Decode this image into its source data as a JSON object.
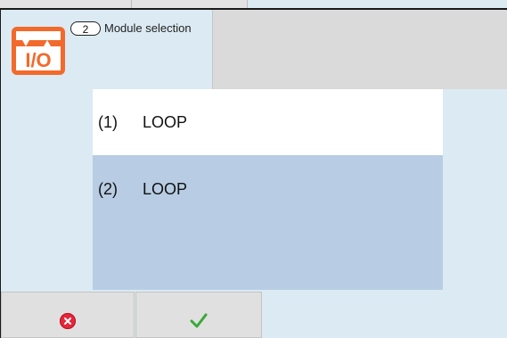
{
  "header": {
    "step_number": "2",
    "title": "Module selection",
    "icon_text": "I/O"
  },
  "modules": [
    {
      "number": "(1)",
      "name": "LOOP",
      "selected": false
    },
    {
      "number": "(2)",
      "name": "LOOP",
      "selected": true
    }
  ],
  "footer": {
    "cancel_icon": "cancel-icon",
    "confirm_icon": "checkmark-icon"
  },
  "colors": {
    "background": "#dbeaf3",
    "selected_row": "#b8cde4",
    "icon_orange": "#f26a2b",
    "cancel_red": "#e6263b",
    "check_green": "#3aa93a"
  }
}
